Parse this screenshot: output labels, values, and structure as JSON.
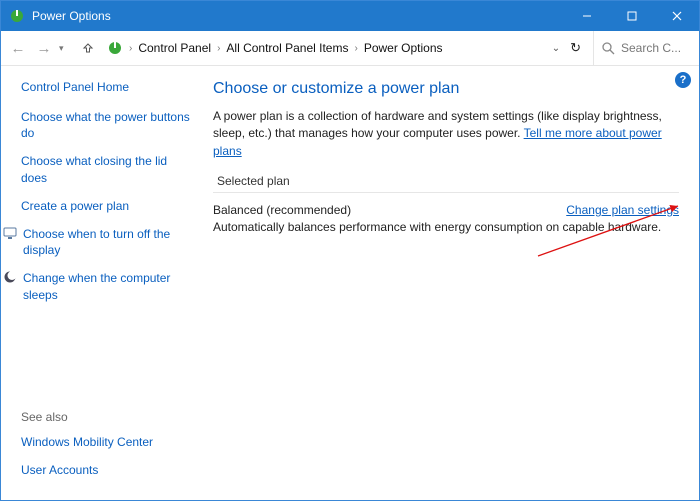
{
  "title": "Power Options",
  "breadcrumb": {
    "seg1": "Control Panel",
    "seg2": "All Control Panel Items",
    "seg3": "Power Options"
  },
  "search": {
    "placeholder": "Search C..."
  },
  "sidebar": {
    "home": "Control Panel Home",
    "links": [
      "Choose what the power buttons do",
      "Choose what closing the lid does",
      "Create a power plan",
      "Choose when to turn off the display",
      "Change when the computer sleeps"
    ],
    "seealso_label": "See also",
    "seealso": [
      "Windows Mobility Center",
      "User Accounts"
    ]
  },
  "main": {
    "heading": "Choose or customize a power plan",
    "description_pre": "A power plan is a collection of hardware and system settings (like display brightness, sleep, etc.) that manages how your computer uses power. ",
    "description_link": "Tell me more about power plans",
    "section": "Selected plan",
    "plan_name": "Balanced (recommended)",
    "change_link": "Change plan settings",
    "plan_desc": "Automatically balances performance with energy consumption on capable hardware."
  }
}
